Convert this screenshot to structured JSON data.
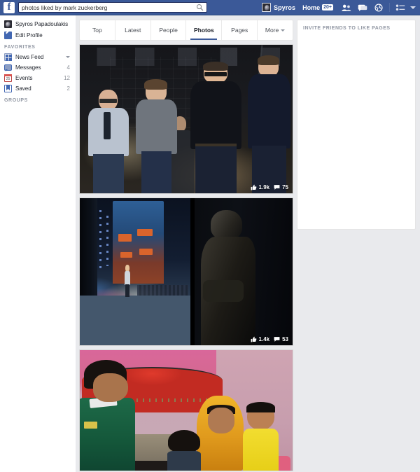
{
  "topbar": {
    "logo": "f",
    "search": {
      "value": "photos liked by mark zuckerberg",
      "placeholder": "Search",
      "icon": "search-icon"
    },
    "profile_name": "Spyros",
    "home_label": "Home",
    "home_badge": "20+",
    "icons": [
      "friend-requests-icon",
      "messages-icon",
      "notifications-icon",
      "privacy-shortcuts-icon",
      "account-menu-caret"
    ]
  },
  "sidebar": {
    "profile": {
      "label": "Spyros Papadoulakis",
      "icon": "avatar-icon"
    },
    "edit_profile": {
      "label": "Edit Profile",
      "icon": "pencil-icon"
    },
    "favorites_header": "FAVORITES",
    "favorites": [
      {
        "label": "News Feed",
        "icon": "news-feed-icon",
        "count": "",
        "has_caret": true
      },
      {
        "label": "Messages",
        "icon": "messages-icon",
        "count": "4",
        "has_caret": false
      },
      {
        "label": "Events",
        "icon": "calendar-icon",
        "count": "12",
        "has_caret": false
      },
      {
        "label": "Saved",
        "icon": "bookmark-icon",
        "count": "2",
        "has_caret": false
      }
    ],
    "groups_header": "GROUPS"
  },
  "tabs": [
    {
      "label": "Top",
      "active": false
    },
    {
      "label": "Latest",
      "active": false
    },
    {
      "label": "People",
      "active": false
    },
    {
      "label": "Photos",
      "active": true
    },
    {
      "label": "Pages",
      "active": false
    },
    {
      "label": "More",
      "active": false,
      "caret": true
    }
  ],
  "photos": [
    {
      "alt": "Four men standing backstage in a dark studio",
      "likes": "1.9k",
      "comments": "75"
    },
    {
      "alt": "Diptych: performer on a lit stage and a silhouetted person in the wings",
      "likes": "1.4k",
      "comments": "53"
    },
    {
      "alt": "A family sitting on a bed in a pink room",
      "likes": "",
      "comments": ""
    }
  ],
  "right_column": {
    "invite_card_title": "INVITE FRIENDS TO LIKE PAGES"
  },
  "colors": {
    "chrome_blue": "#3b5998",
    "page_background": "#e9eaed",
    "card_white": "#ffffff",
    "muted_text": "#9197a3",
    "active_tab_underline": "#3b5998"
  }
}
